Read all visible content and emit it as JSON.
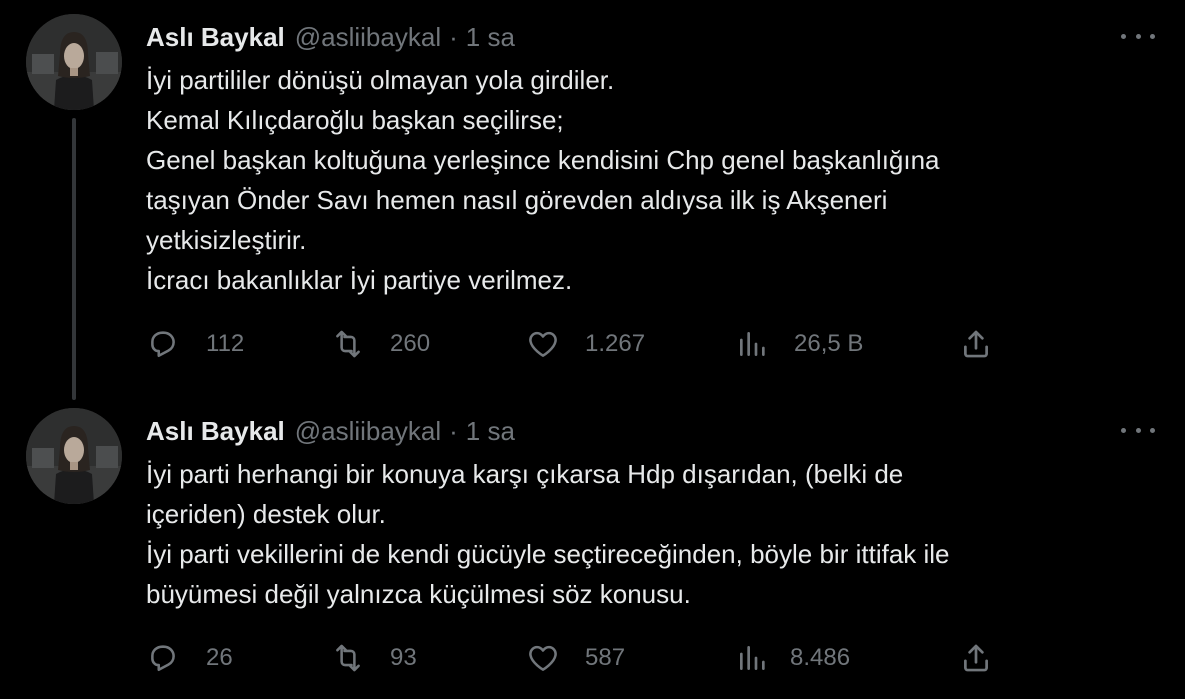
{
  "tweets": [
    {
      "author_name": "Aslı Baykal",
      "handle": "@asliibaykal",
      "separator": "·",
      "time": "1 sa",
      "lines": [
        "İyi partililer dönüşü olmayan yola girdiler.",
        "Kemal Kılıçdaroğlu başkan seçilirse;",
        "Genel başkan koltuğuna yerleşince kendisini Chp genel başkanlığına",
        "taşıyan Önder Savı hemen nasıl görevden aldıysa ilk iş Akşeneri",
        "yetkisizleştirir.",
        "İcracı bakanlıklar İyi partiye verilmez."
      ],
      "stats": {
        "replies": "112",
        "retweets": "260",
        "likes": "1.267",
        "views": "26,5 B"
      }
    },
    {
      "author_name": "Aslı Baykal",
      "handle": "@asliibaykal",
      "separator": "·",
      "time": "1 sa",
      "lines": [
        "İyi parti herhangi bir konuya karşı çıkarsa Hdp dışarıdan, (belki de",
        "içeriden) destek olur.",
        "İyi parti vekillerini de kendi gücüyle seçtireceğinden, böyle bir ittifak ile",
        "büyümesi değil yalnızca küçülmesi söz konusu."
      ],
      "stats": {
        "replies": "26",
        "retweets": "93",
        "likes": "587",
        "views": "8.486"
      }
    }
  ],
  "icons": {
    "reply": "reply-icon",
    "retweet": "retweet-icon",
    "like": "heart-icon",
    "views": "views-chart-icon",
    "share": "share-icon",
    "more": "more-options-icon"
  },
  "colors": {
    "background": "#000000",
    "text": "#e7e9ea",
    "secondary": "#71767b",
    "thread_line": "#333639"
  }
}
